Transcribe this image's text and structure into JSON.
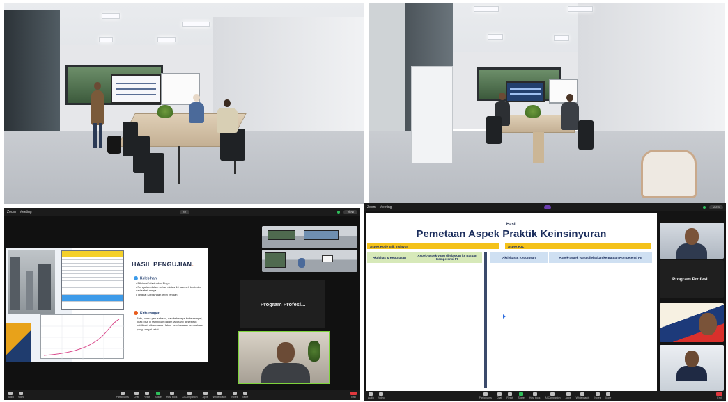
{
  "zoom1": {
    "top_bar": {
      "app": "Zoom",
      "app_sub": "Workplace",
      "title": "Meeting",
      "view_pill": "View"
    },
    "slide": {
      "title": "HASIL PENGUJIAN",
      "advantages_heading": "Kelebihan",
      "advantages": [
        "Efisiensi Waktu dan Biaya",
        "Pengujian dalam sehari diatas 10 sampel, berbeda dari sebelumnya",
        "Tingkat Kebisingan lebih rendah"
      ],
      "disadvantages_heading": "Kekurangan",
      "disadvantages_text": "Batu, nama perusahaan, dan beberapa kode sampel, tidak bisa di tampilkan dalam laporan / di seluruh publikasi, dikarenakan faktor kerahasiaan perusahaan yang sangat ketat."
    },
    "gallery": {
      "tile_name": "",
      "program_label": "Program Profesi...",
      "cam_name": "",
      "cam_presenter": ""
    },
    "toolbar": [
      "Audio",
      "Video",
      "Participants",
      "Chat",
      "React",
      "Share",
      "Host tools",
      "AI Companion",
      "Apps",
      "Whiteboards",
      "Notes",
      "More"
    ],
    "end_label": "End"
  },
  "zoom2": {
    "top_bar": {
      "app": "Zoom",
      "app_sub": "Workplace",
      "title": "Meeting",
      "pill": "",
      "view_pill": "View"
    },
    "slide": {
      "kicker": "Hasil",
      "title": "Pemetaan Aspek Praktik Keinsinyuran",
      "group_left": "Aspek Kode Etik Insinyur",
      "group_right": "Aspek K3L",
      "headers": [
        "Aktivitas & Keputusan",
        "Aspek-aspek yang dijelaskan ke Batuan Kompetensi PII",
        "Aktivitas & Keputusan",
        "Aspek-aspek yang dijelaskan ke Batuan Kompetensi PII"
      ],
      "rows": [
        [
          "",
          "",
          "",
          ""
        ],
        [
          "",
          "",
          "",
          ""
        ],
        [
          "",
          "",
          "",
          ""
        ]
      ]
    },
    "gallery": {
      "program_label": "Program Profesi...",
      "tile_names": [
        "",
        "",
        "",
        ""
      ]
    },
    "toolbar": [
      "Audio",
      "Video",
      "Participants",
      "Chat",
      "React",
      "Share",
      "Host tools",
      "AI Companion",
      "Apps",
      "Whiteboards",
      "Notes",
      "More"
    ],
    "end_label": "End"
  },
  "colors": {
    "accent_yellow": "#f4c21a",
    "zoom_green": "#2fbf5b",
    "end_red": "#e0383e",
    "slide_navy": "#1b2d5c"
  }
}
